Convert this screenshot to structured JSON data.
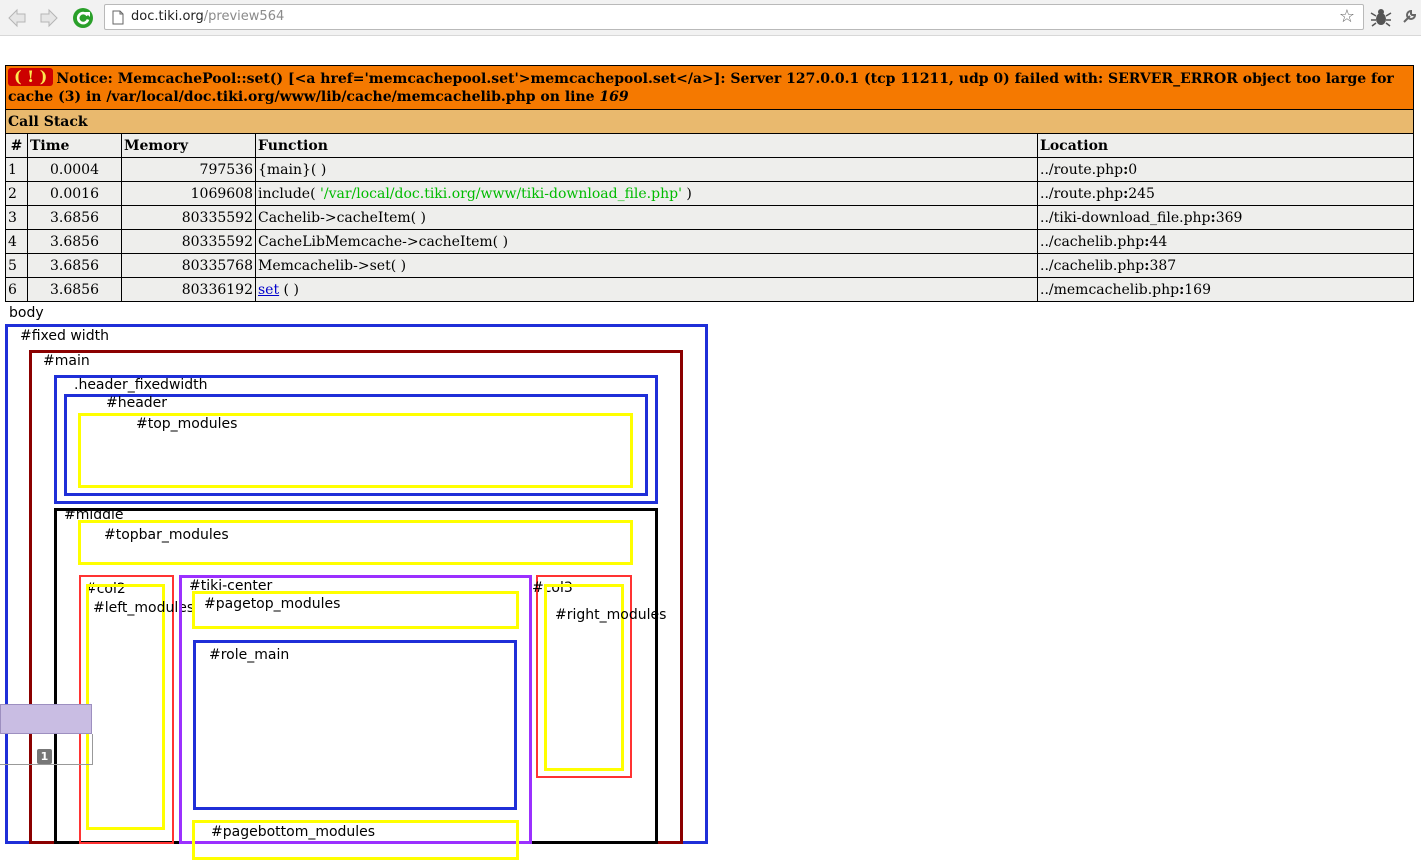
{
  "browser": {
    "url_host": "doc.tiki.org",
    "url_path": "/preview564"
  },
  "error": {
    "badge": "( ! )",
    "message_prefix": "Notice: MemcachePool::set() [<a href='memcachepool.set'>memcachepool.set</a>]: Server 127.0.0.1 (tcp 11211, udp 0) failed with: SERVER_ERROR object too large for cache (3) in /var/local/doc.tiki.org/www/lib/cache/memcachelib.php on line ",
    "line": "169",
    "call_stack_label": "Call Stack",
    "columns": [
      "#",
      "Time",
      "Memory",
      "Function",
      "Location"
    ],
    "rows": [
      {
        "num": "1",
        "time": "0.0004",
        "memory": "797536",
        "func": "{main}( )",
        "func_arg": "",
        "func_end": "",
        "func_link": "",
        "loc_file": "../route.php",
        "loc_sep": ":",
        "loc_line": "0"
      },
      {
        "num": "2",
        "time": "0.0016",
        "memory": "1069608",
        "func": "include( ",
        "func_arg": "'/var/local/doc.tiki.org/www/tiki-download_file.php'",
        "func_end": " )",
        "func_link": "",
        "loc_file": "../route.php",
        "loc_sep": ":",
        "loc_line": "245"
      },
      {
        "num": "3",
        "time": "3.6856",
        "memory": "80335592",
        "func": "Cachelib->cacheItem( )",
        "func_arg": "",
        "func_end": "",
        "func_link": "",
        "loc_file": "../tiki-download_file.php",
        "loc_sep": ":",
        "loc_line": "369"
      },
      {
        "num": "4",
        "time": "3.6856",
        "memory": "80335592",
        "func": "CacheLibMemcache->cacheItem( )",
        "func_arg": "",
        "func_end": "",
        "func_link": "",
        "loc_file": "../cachelib.php",
        "loc_sep": ":",
        "loc_line": "44"
      },
      {
        "num": "5",
        "time": "3.6856",
        "memory": "80335768",
        "func": "Memcachelib->set( )",
        "func_arg": "",
        "func_end": "",
        "func_link": "",
        "loc_file": "../cachelib.php",
        "loc_sep": ":",
        "loc_line": "387"
      },
      {
        "num": "6",
        "time": "3.6856",
        "memory": "80336192",
        "func": "",
        "func_arg": "",
        "func_end": " ( )",
        "func_link": "set",
        "loc_file": "../memcachelib.php",
        "loc_sep": ":",
        "loc_line": "169"
      }
    ]
  },
  "layout_diagram": {
    "body": "body",
    "fixed_width": "#fixed width",
    "main": "#main",
    "header_fixedwidth": ".header_fixedwidth",
    "header": "#header",
    "top_modules": "#top_modules",
    "middle": "#middle",
    "topbar_modules": "#topbar_modules",
    "col2": "#col2",
    "left_modules": "#left_modules",
    "tiki_center": "#tiki-center",
    "pagetop_modules": "#pagetop_modules",
    "role_main": "#role_main",
    "pagebottom_modules": "#pagebottom_modules",
    "col3": "#col3",
    "right_modules": "#right_modules",
    "marker": "1"
  },
  "colors": {
    "notice_bg": "#f57900",
    "callstack_bg": "#e9b96e",
    "row_bg": "#eeeeec",
    "blue_box": "#1f2fd8",
    "yellow_box": "#ffff00",
    "red_box": "#ff3333",
    "purple_box": "#9b30ff"
  }
}
